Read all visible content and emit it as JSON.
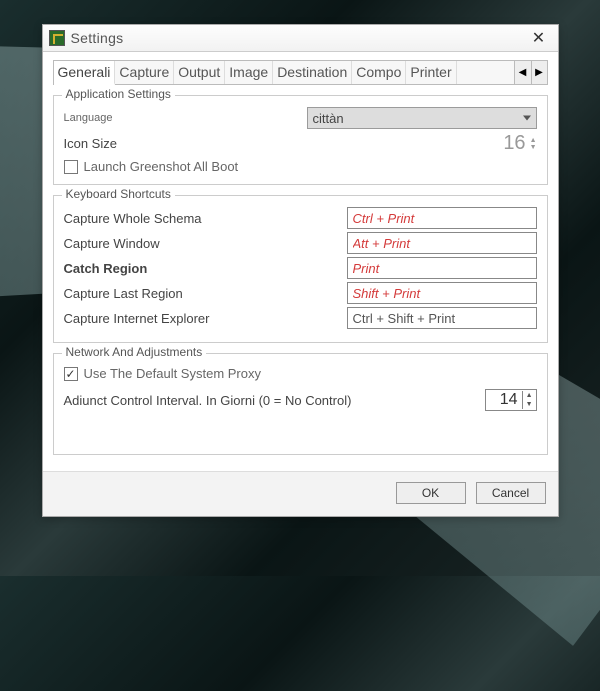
{
  "window": {
    "title": "Settings"
  },
  "tabs": {
    "items": [
      "Generali",
      "Capture",
      "Output",
      "Image",
      "Destination",
      "Compo",
      "Printer"
    ],
    "active_index": 0
  },
  "app_settings": {
    "legend": "Application Settings",
    "language_label": "Language",
    "language_value": "cittàn",
    "icon_size_label": "Icon Size",
    "icon_size_value": "16",
    "launch_boot_label": "Launch Greenshot All Boot",
    "launch_boot_checked": false
  },
  "shortcuts": {
    "legend": "Keyboard Shortcuts",
    "rows": [
      {
        "label": "Capture Whole Schema",
        "value": "Ctrl + Print"
      },
      {
        "label": "Capture Window",
        "value": "Att + Print"
      },
      {
        "label": "Catch Region",
        "value": "Print"
      },
      {
        "label": "Capture Last Region",
        "value": "Shift + Print"
      },
      {
        "label": "Capture Internet Explorer",
        "value": "Ctrl + Shift + Print"
      }
    ]
  },
  "network": {
    "legend": "Network And Adjustments",
    "use_proxy_label": "Use The Default System Proxy",
    "use_proxy_checked": true,
    "interval_label": "Adiunct Control Interval. In Giorni (0 = No Control)",
    "interval_value": "14"
  },
  "buttons": {
    "ok": "OK",
    "cancel": "Cancel"
  }
}
